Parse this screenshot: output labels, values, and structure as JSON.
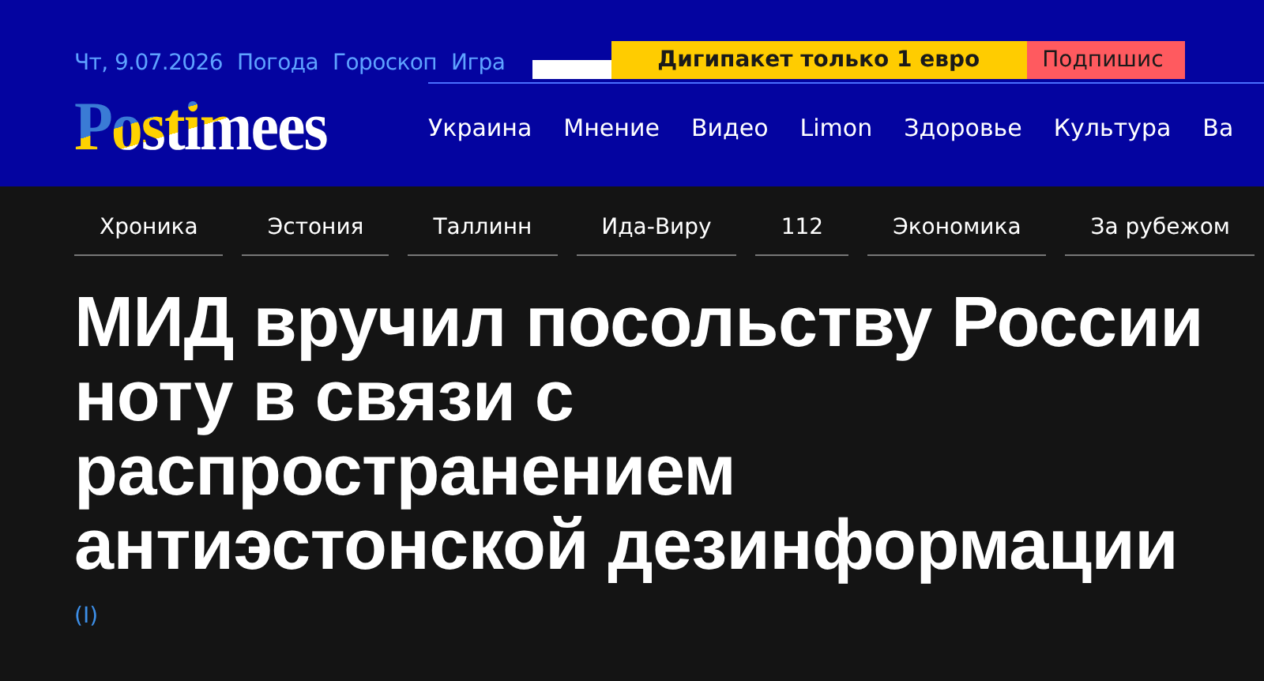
{
  "top_links": [
    "Чт, 9.07.2026",
    "Погода",
    "Гороскоп",
    "Игра"
  ],
  "promo_button": "Дигипакет только 1 евро",
  "subscribe_button": "Подпишис",
  "logo": "Postimees",
  "main_nav": [
    "Украина",
    "Мнение",
    "Видео",
    "Limon",
    "Здоровье",
    "Культура",
    "Ва"
  ],
  "section_nav": [
    "Хроника",
    "Эстония",
    "Таллинн",
    "Ида-Виру",
    "112",
    "Экономика",
    "За рубежом"
  ],
  "headline": "МИД вручил посольству России ноту в связи с распространением антиэстонской дезинформации",
  "author_mark": "(I)"
}
